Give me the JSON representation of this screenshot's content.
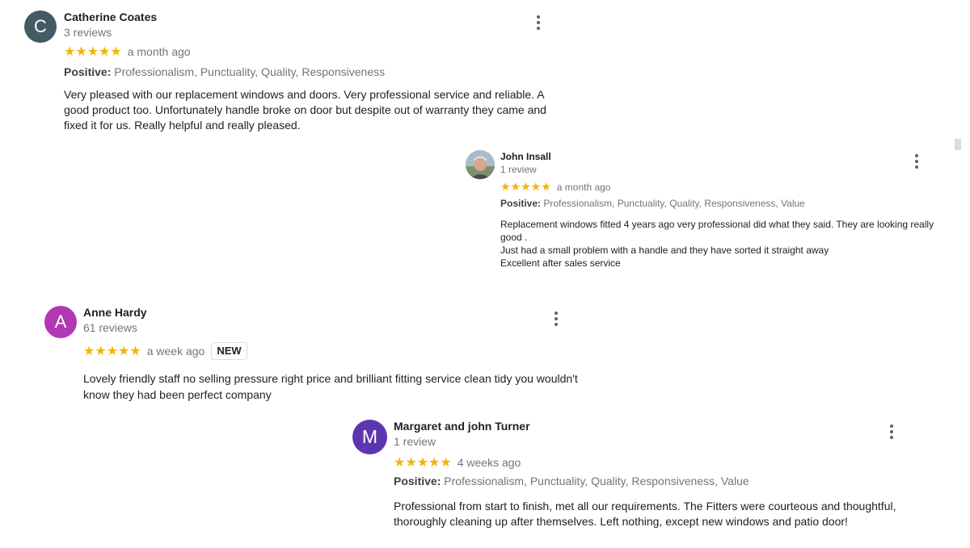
{
  "reviews": [
    {
      "initial": "C",
      "avatar_color": "#455a64",
      "name": "Catherine Coates",
      "count": "3 reviews",
      "stars": "★★★★★",
      "date": "a month ago",
      "positive_label": "Positive:",
      "positive_values": "Professionalism, Punctuality, Quality, Responsiveness",
      "text": "Very pleased with our replacement windows and doors. Very professional service and reliable. A good product too. Unfortunately handle broke on door but despite out of warranty they came and fixed it for us. Really helpful and really pleased."
    },
    {
      "initial": "",
      "avatar_color": "#8fa3b4",
      "name": "John Insall",
      "count": "1 review",
      "stars": "★★★★★",
      "date": "a month ago",
      "positive_label": "Positive:",
      "positive_values": "Professionalism, Punctuality, Quality, Responsiveness, Value",
      "text_lines": [
        "Replacement windows fitted 4 years  ago very professional did what they said. They are looking really good .",
        "Just had a small problem with a handle and they have sorted it straight away",
        "Excellent after sales service"
      ]
    },
    {
      "initial": "A",
      "avatar_color": "#b237b5",
      "name": "Anne Hardy",
      "count": "61 reviews",
      "stars": "★★★★★",
      "date": "a week ago",
      "badge": "NEW",
      "text": "Lovely friendly staff no selling pressure right price and brilliant fitting service clean tidy you wouldn't know they had been perfect company"
    },
    {
      "initial": "M",
      "avatar_color": "#5e35b1",
      "name": "Margaret and john Turner",
      "count": "1 review",
      "stars": "★★★★★",
      "date": "4 weeks ago",
      "positive_label": "Positive:",
      "positive_values": "Professionalism, Punctuality, Quality, Responsiveness, Value",
      "text": "Professional from start to finish, met all our requirements. The Fitters were courteous and thoughtful, thoroughly cleaning up after themselves.  Left nothing, except new windows and patio door!"
    }
  ],
  "icons": {
    "more": "more-vert-icon",
    "star": "star-icon",
    "photo": "user-photo"
  }
}
